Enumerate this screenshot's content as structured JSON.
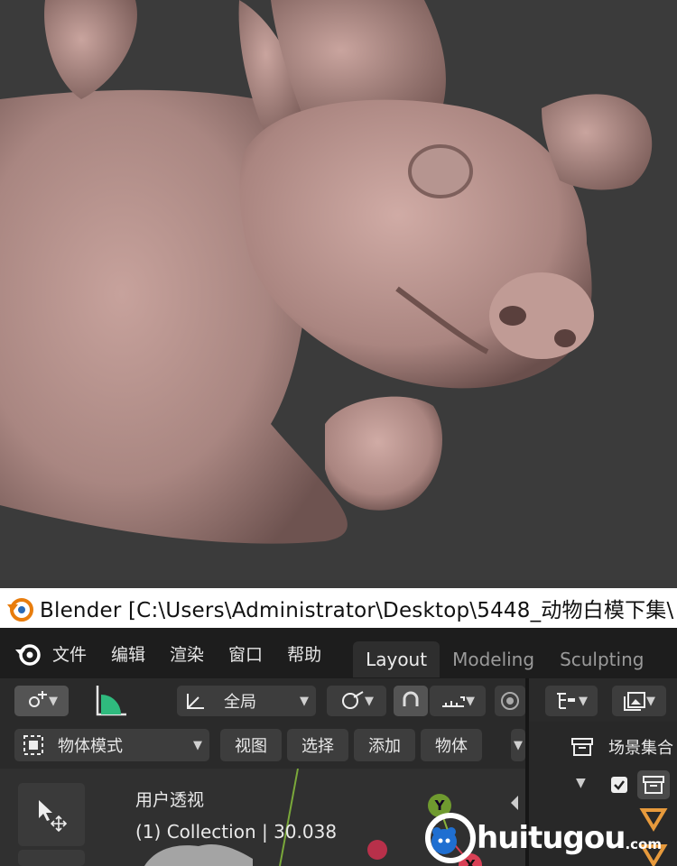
{
  "window": {
    "title": "Blender [C:\\Users\\Administrator\\Desktop\\5448_动物白模下集\\"
  },
  "menu": {
    "items": [
      "文件",
      "编辑",
      "渲染",
      "窗口",
      "帮助"
    ]
  },
  "workspaces": {
    "tabs": [
      "Layout",
      "Modeling",
      "Sculpting"
    ],
    "active": "Layout"
  },
  "viewport_header": {
    "transform_orientation": "全局",
    "mode": "物体模式",
    "menus": [
      "视图",
      "选择",
      "添加",
      "物体"
    ]
  },
  "viewport_overlay": {
    "view_name": "用户透视",
    "collection_info": "(1) Collection | 30.038"
  },
  "gizmo": {
    "y_label": "Y",
    "x_label": "X"
  },
  "outliner": {
    "scene_collection": "场景集合"
  },
  "watermark": {
    "text": "huitugou",
    "suffix": ".com"
  },
  "colors": {
    "render_bg": "#3b3b3b",
    "clay": "#b08c87",
    "menubar_bg": "#1d1d1d",
    "outliner_orange": "#e79a3c",
    "gizmo_y": "#8ab33a",
    "gizmo_x": "#d84055"
  }
}
